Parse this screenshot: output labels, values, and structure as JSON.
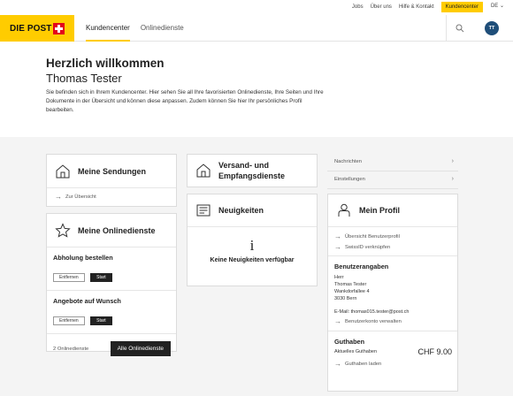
{
  "topbar": {
    "links": [
      "Jobs",
      "Über uns",
      "Hilfe & Kontakt"
    ],
    "highlighted_link": "Kundencenter",
    "language": "DE",
    "language_chevron": "⌄"
  },
  "header": {
    "logo_text": "DIE POST",
    "nav": [
      "Kundencenter",
      "Onlinedienste"
    ],
    "avatar_initials": "TT",
    "accent_color": "#ffcc00",
    "logo_cross_color": "#e3001b"
  },
  "welcome": {
    "title": "Herzlich willkommen",
    "name": "Thomas Tester",
    "description": "Sie befinden sich in Ihrem Kundencenter. Hier sehen Sie all Ihre favorisierten Onlinedienste, Ihre Seiten und Ihre Dokumente in der Übersicht und können diese anpassen. Zudem können Sie hier Ihr persönliches Profil bearbeiten."
  },
  "sendungen": {
    "title": "Meine Sendungen",
    "link": "Zur Übersicht"
  },
  "onlinedienste": {
    "title": "Meine Onlinedienste",
    "items": [
      {
        "title": "Abholung bestellen",
        "remove": "Entfernen",
        "start": "Start"
      },
      {
        "title": "Angebote auf Wunsch",
        "remove": "Entfernen",
        "start": "Start"
      }
    ],
    "count": "2 Onlinedienste",
    "all_button": "Alle Onlinedienste"
  },
  "versand": {
    "title_line1": "Versand- und",
    "title_line2": "Empfangsdienste"
  },
  "neuigkeiten": {
    "title": "Neuigkeiten",
    "info_glyph": "i",
    "empty_text": "Keine Neuigkeiten verfügbar"
  },
  "menu": [
    {
      "label": "Nachrichten",
      "chevron": "›"
    },
    {
      "label": "Einstellungen",
      "chevron": "›"
    }
  ],
  "profil": {
    "title": "Mein Profil",
    "links": [
      "Übersicht Benutzerprofil",
      "SwissID verknüpfen"
    ],
    "benutzerangaben": {
      "title": "Benutzerangaben",
      "salutation": "Herr",
      "name": "Thomas Tester",
      "street": "Wankdorfallee 4",
      "city": "3030 Bern",
      "email": "E-Mail: thomas015.tester@post.ch",
      "manage_link": "Benutzerkonto verwalten"
    },
    "guthaben": {
      "title": "Guthaben",
      "label": "Aktuelles Guthaben",
      "amount": "CHF 9.00",
      "load_link": "Guthaben laden"
    }
  }
}
